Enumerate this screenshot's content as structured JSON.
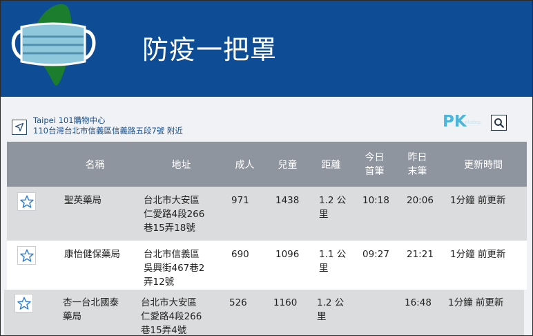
{
  "header": {
    "title": "防疫一把罩"
  },
  "location": {
    "name": "Taipei 101購物中心",
    "address": "110台灣台北市信義區信義路五段7號 附近"
  },
  "brand": {
    "main": "PK",
    "sub": "pkstep"
  },
  "table": {
    "headers": {
      "name": "名稱",
      "address": "地址",
      "adult": "成人",
      "child": "兒童",
      "distance": "距離",
      "first_line1": "今日",
      "first_line2": "首筆",
      "last_line1": "昨日",
      "last_line2": "末筆",
      "updated": "更新時間"
    },
    "rows": [
      {
        "name_line1": "聖英藥局",
        "name_line2": "",
        "addr_line1": "台北市大安區",
        "addr_line2": "仁愛路4段266",
        "addr_line3": "巷15弄18號",
        "adult": "971",
        "child": "1438",
        "dist_line1": "1.2 公",
        "dist_line2": "里",
        "first": "10:18",
        "last": "20:06",
        "updated": "1分鐘 前更新"
      },
      {
        "name_line1": "康怡健保藥局",
        "name_line2": "",
        "addr_line1": "台北市信義區",
        "addr_line2": "吳興街467巷2",
        "addr_line3": "弄12號",
        "adult": "690",
        "child": "1096",
        "dist_line1": "1.1 公",
        "dist_line2": "里",
        "first": "09:27",
        "last": "21:21",
        "updated": "1分鐘 前更新"
      },
      {
        "name_line1": "杏一台北國泰",
        "name_line2": "藥局",
        "addr_line1": "台北市大安區",
        "addr_line2": "仁愛路4段266",
        "addr_line3": "巷15弄4號",
        "adult": "526",
        "child": "1160",
        "dist_line1": "1.2 公",
        "dist_line2": "里",
        "first": "",
        "last": "16:48",
        "updated": "1分鐘 前更新"
      }
    ]
  },
  "icons": {
    "logo": "taiwan-mask-logo-icon",
    "locate": "navigation-arrow-icon",
    "search": "search-icon",
    "favorite": "star-outline-icon"
  },
  "colors": {
    "header_bg": "#0f4c96",
    "table_header_bg": "#8e959e",
    "row_gray": "#dbdcdd",
    "link_blue": "#1a4f8a",
    "star_blue": "#2d7fd6"
  }
}
